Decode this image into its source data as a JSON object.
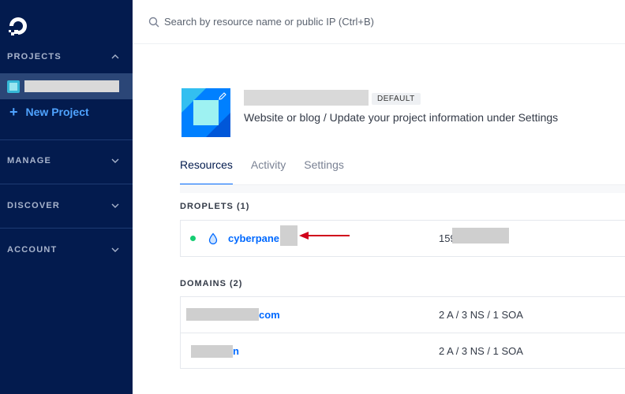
{
  "sidebar": {
    "projects_label": "PROJECTS",
    "new_project_label": "New Project",
    "manage_label": "MANAGE",
    "discover_label": "DISCOVER",
    "account_label": "ACCOUNT"
  },
  "search": {
    "placeholder": "Search by resource name or public IP (Ctrl+B)"
  },
  "project": {
    "default_badge": "DEFAULT",
    "description": "Website or blog / Update your project information under Settings"
  },
  "tabs": [
    {
      "label": "Resources",
      "active": true
    },
    {
      "label": "Activity",
      "active": false
    },
    {
      "label": "Settings",
      "active": false
    }
  ],
  "droplets": {
    "header": "DROPLETS (1)",
    "items": [
      {
        "name": "cyberpane",
        "ip_visible": "159",
        "status": "active"
      }
    ]
  },
  "domains": {
    "header": "DOMAINS (2)",
    "items": [
      {
        "name_visible": "com",
        "records": "2 A / 3 NS / 1 SOA"
      },
      {
        "name_visible": "n",
        "records": "2 A / 3 NS / 1 SOA"
      }
    ]
  },
  "colors": {
    "sidebar_bg": "#031b4e",
    "accent": "#0069ff",
    "status_green": "#15cd72",
    "annotation_arrow": "#d0021b"
  }
}
